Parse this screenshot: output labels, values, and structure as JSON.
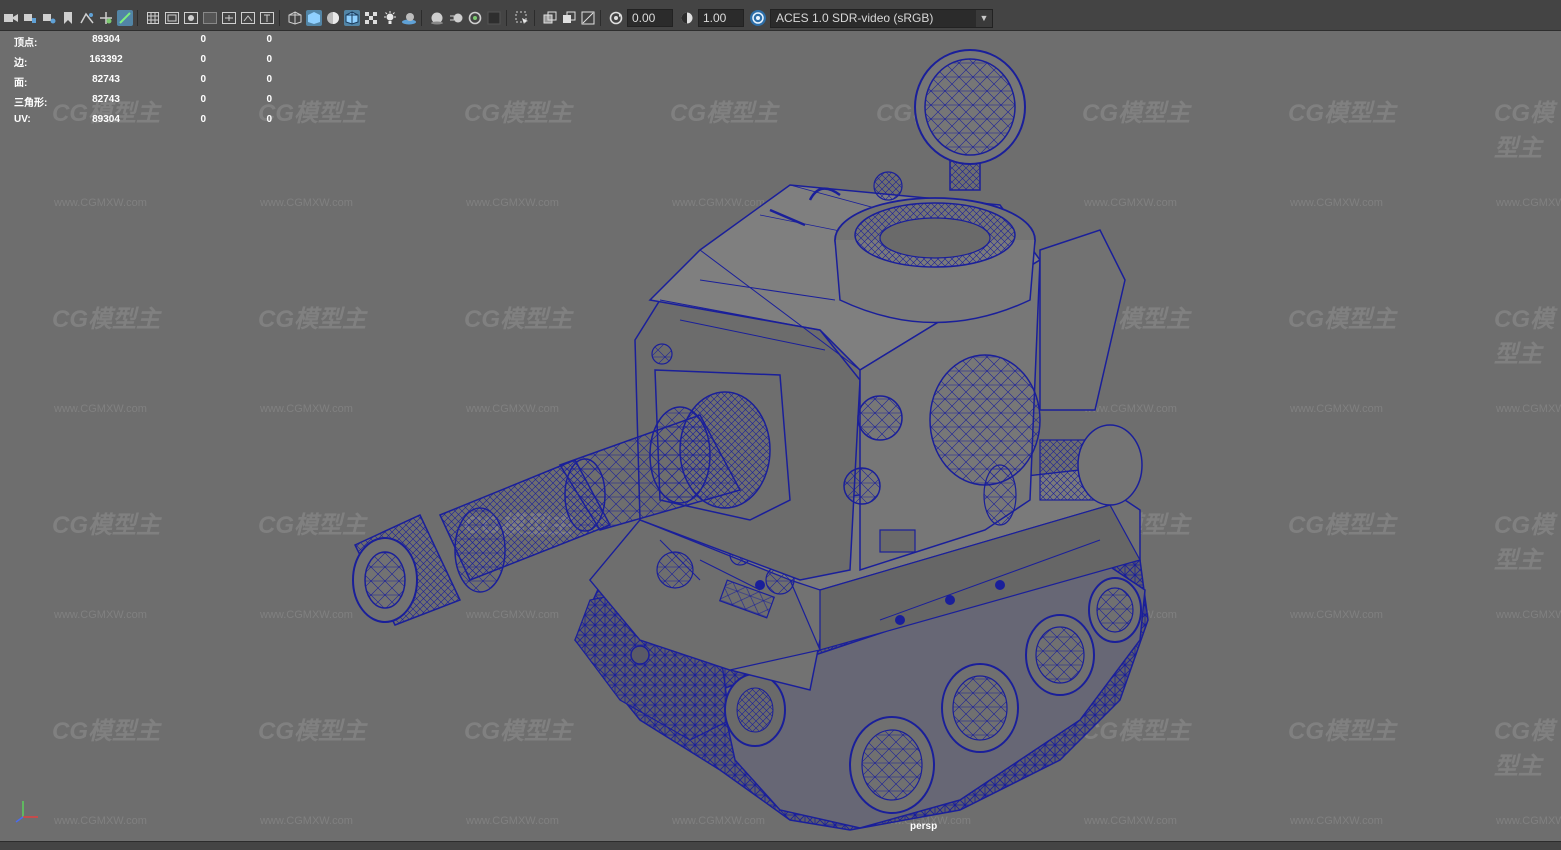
{
  "menu": [],
  "toolbar": {
    "exposure_value": "0.00",
    "gamma_value": "1.00",
    "colorspace": "ACES 1.0 SDR-video (sRGB)"
  },
  "hud": {
    "rows": [
      {
        "label": "顶点:",
        "v1": "89304",
        "v2": "0",
        "v3": "0"
      },
      {
        "label": "边:",
        "v1": "163392",
        "v2": "0",
        "v3": "0"
      },
      {
        "label": "面:",
        "v1": "82743",
        "v2": "0",
        "v3": "0"
      },
      {
        "label": "三角形:",
        "v1": "82743",
        "v2": "0",
        "v3": "0"
      },
      {
        "label": "UV:",
        "v1": "89304",
        "v2": "0",
        "v3": "0"
      }
    ]
  },
  "viewport": {
    "camera": "persp",
    "watermark_logo": "CG模型主",
    "watermark_url": "www.CGMXW.com",
    "wireframe_color": "#1a1f9a",
    "background_color": "#6e6e6e"
  },
  "icons": [
    "camera-icon",
    "lock-camera-icon",
    "bookmark-icon",
    "grid-icon",
    "film-gate-icon",
    "wireframe-icon",
    "smooth-shade-icon",
    "textured-icon",
    "lights-icon",
    "shadows-icon",
    "isolate-icon",
    "exposure-icon",
    "gamma-icon",
    "colorspace-icon"
  ]
}
